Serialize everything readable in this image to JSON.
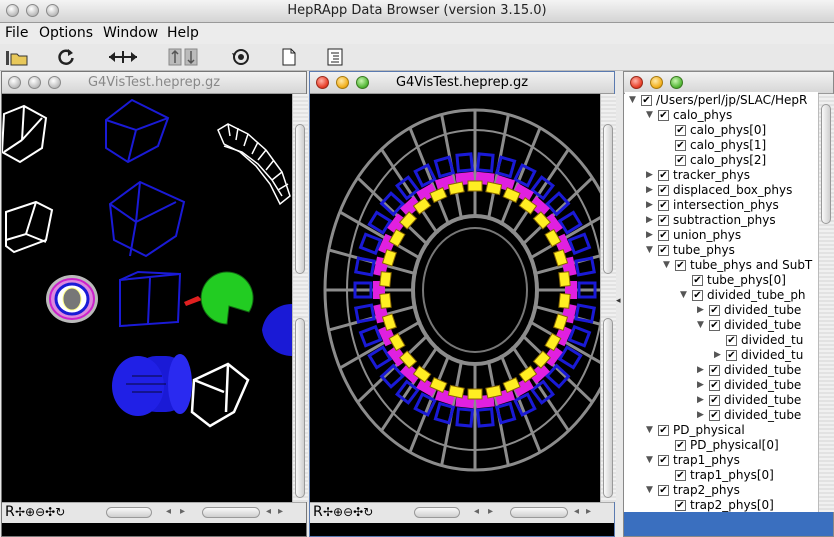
{
  "window": {
    "title": "HepRApp Data Browser (version 3.15.0)"
  },
  "menu": [
    "File",
    "Options",
    "Window",
    "Help"
  ],
  "toolbar_icons": [
    "open-folder-icon",
    "refresh-icon",
    "horizontal-arrows-icon",
    "vertical-arrows-icon",
    "spin-icon",
    "new-page-icon",
    "tree-view-icon"
  ],
  "left_view": {
    "title": "G4VisTest.heprep.gz",
    "status_label": "R"
  },
  "center_view": {
    "title": "G4VisTest.heprep.gz",
    "status_label": "R"
  },
  "tree": [
    {
      "label": "/Users/perl/jp/SLAC/HepR",
      "depth": 0,
      "toggle": "down"
    },
    {
      "label": "calo_phys",
      "depth": 1,
      "toggle": "down"
    },
    {
      "label": "calo_phys[0]",
      "depth": 2,
      "toggle": ""
    },
    {
      "label": "calo_phys[1]",
      "depth": 2,
      "toggle": ""
    },
    {
      "label": "calo_phys[2]",
      "depth": 2,
      "toggle": ""
    },
    {
      "label": "tracker_phys",
      "depth": 1,
      "toggle": "right"
    },
    {
      "label": "displaced_box_phys",
      "depth": 1,
      "toggle": "right"
    },
    {
      "label": "intersection_phys",
      "depth": 1,
      "toggle": "right"
    },
    {
      "label": "subtraction_phys",
      "depth": 1,
      "toggle": "right"
    },
    {
      "label": "union_phys",
      "depth": 1,
      "toggle": "right"
    },
    {
      "label": "tube_phys",
      "depth": 1,
      "toggle": "down"
    },
    {
      "label": "tube_phys and SubT",
      "depth": 2,
      "toggle": "down"
    },
    {
      "label": "tube_phys[0]",
      "depth": 3,
      "toggle": ""
    },
    {
      "label": "divided_tube_ph",
      "depth": 3,
      "toggle": "down"
    },
    {
      "label": "divided_tube",
      "depth": 4,
      "toggle": "right"
    },
    {
      "label": "divided_tube",
      "depth": 4,
      "toggle": "down"
    },
    {
      "label": "divided_tu",
      "depth": 5,
      "toggle": ""
    },
    {
      "label": "divided_tu",
      "depth": 5,
      "toggle": "right"
    },
    {
      "label": "divided_tube",
      "depth": 4,
      "toggle": "right"
    },
    {
      "label": "divided_tube",
      "depth": 4,
      "toggle": "right"
    },
    {
      "label": "divided_tube",
      "depth": 4,
      "toggle": "right"
    },
    {
      "label": "divided_tube",
      "depth": 4,
      "toggle": "right"
    },
    {
      "label": "PD_physical",
      "depth": 1,
      "toggle": "down"
    },
    {
      "label": "PD_physical[0]",
      "depth": 2,
      "toggle": ""
    },
    {
      "label": "trap1_phys",
      "depth": 1,
      "toggle": "down"
    },
    {
      "label": "trap1_phys[0]",
      "depth": 2,
      "toggle": ""
    },
    {
      "label": "trap2_phys",
      "depth": 1,
      "toggle": "down"
    },
    {
      "label": "trap2_phys[0]",
      "depth": 2,
      "toggle": ""
    }
  ],
  "colors": {
    "view_bg": "#000000",
    "blue": "#1a1ad6",
    "grey": "#8c8c8c",
    "yellow": "#ffee22",
    "magenta": "#e020e0",
    "selection": "#3a6fbf"
  }
}
